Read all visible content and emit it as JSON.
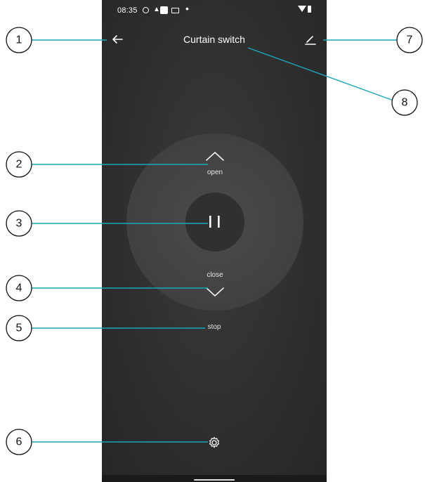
{
  "status_bar": {
    "time": "08:35"
  },
  "app_bar": {
    "title": "Curtain switch"
  },
  "controls": {
    "open_label": "open",
    "close_label": "close",
    "stop_label": "stop"
  },
  "annotations": {
    "line_color": "#1aa6b7",
    "labels": [
      "1",
      "2",
      "3",
      "4",
      "5",
      "6",
      "7",
      "8"
    ]
  },
  "colors": {
    "background": "#2f2f2f",
    "dial": "#444444",
    "pause_button": "#303030",
    "text": "#ffffff"
  },
  "icons": {
    "back": "arrow-left-icon",
    "edit": "pencil-icon",
    "open": "chevron-up-icon",
    "pause": "pause-icon",
    "close": "chevron-down-icon",
    "settings": "gear-icon"
  }
}
